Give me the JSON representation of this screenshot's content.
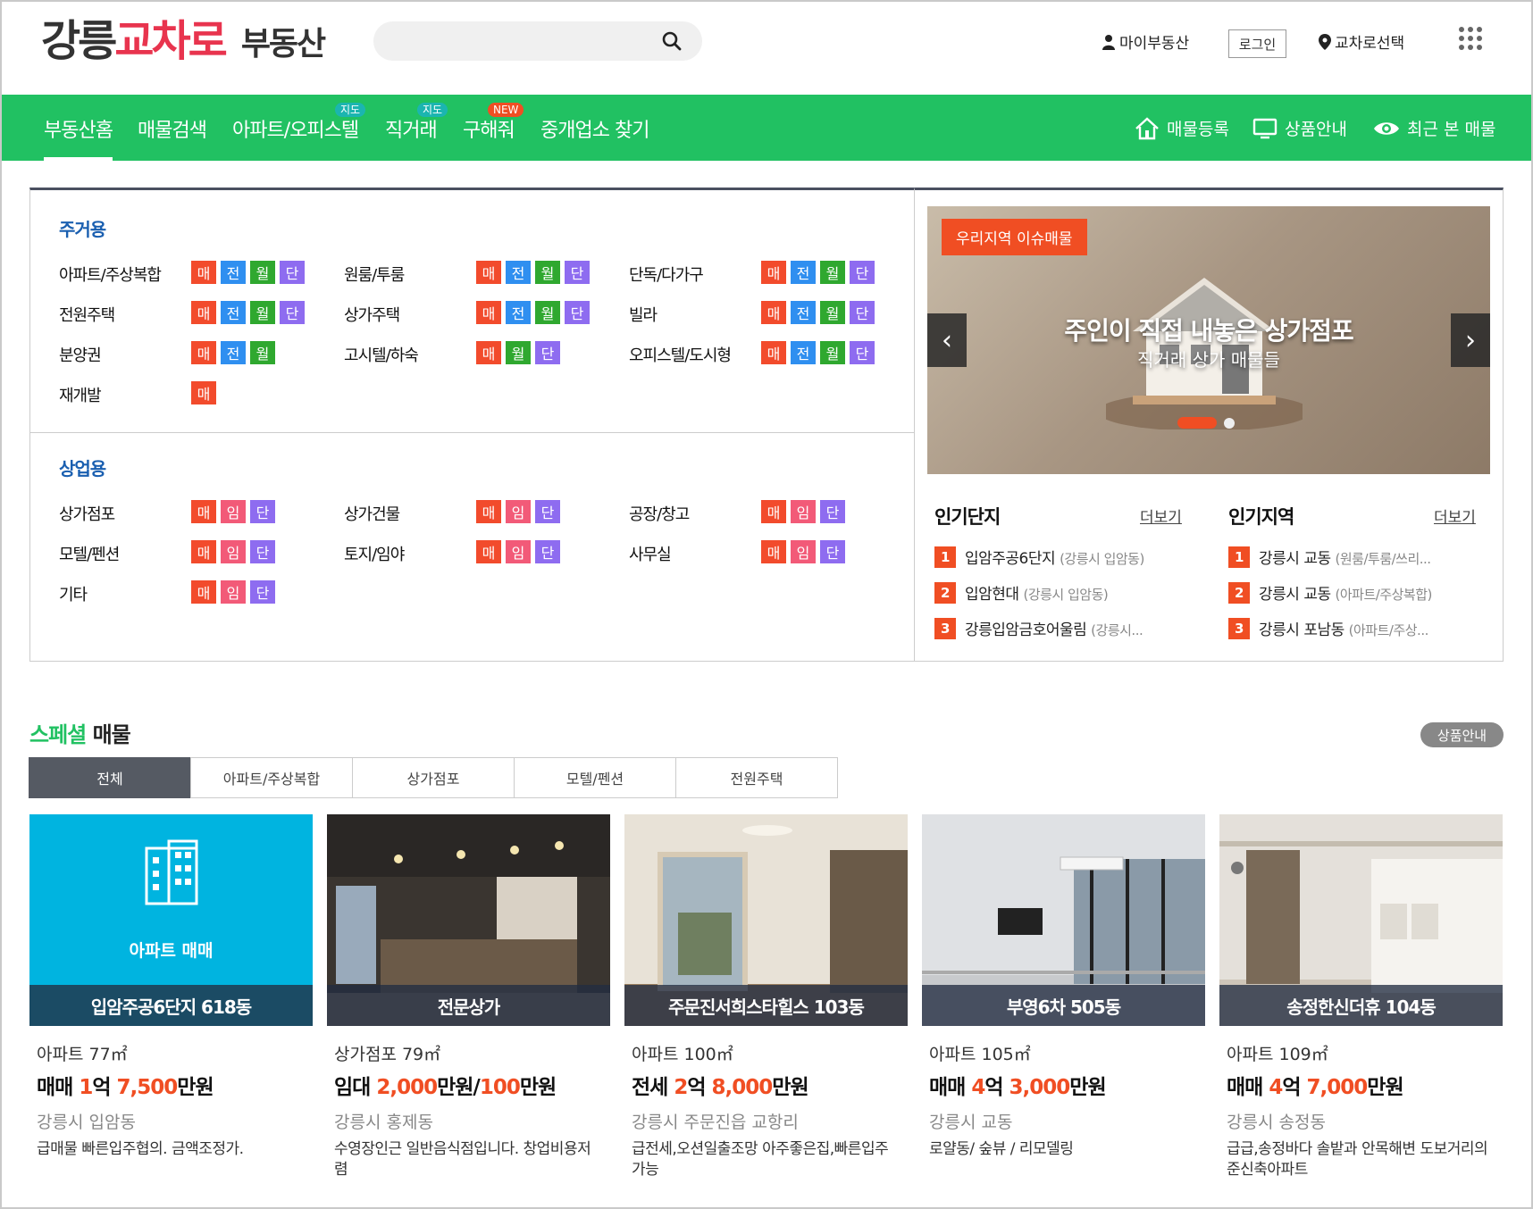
{
  "header": {
    "logo": {
      "part1": "강릉",
      "part2": "교차로",
      "part3": "부동산"
    },
    "search_placeholder": "",
    "my_realty": "마이부동산",
    "login": "로그인",
    "region_select": "교차로선택"
  },
  "nav": {
    "items": [
      {
        "label": "부동산홈",
        "badge": ""
      },
      {
        "label": "매물검색",
        "badge": ""
      },
      {
        "label": "아파트/오피스텔",
        "badge": "지도"
      },
      {
        "label": "직거래",
        "badge": "지도"
      },
      {
        "label": "구해줘",
        "badge": "NEW"
      },
      {
        "label": "중개업소 찾기",
        "badge": ""
      }
    ],
    "right": {
      "register": "매물등록",
      "products": "상품안내",
      "recent": "최근 본 매물"
    }
  },
  "tags": {
    "mae": "매",
    "jeon": "전",
    "wol": "월",
    "dan": "단",
    "im": "임"
  },
  "residential": {
    "title": "주거용",
    "rows": [
      [
        "아파트/주상복합",
        "원룸/투룸",
        "단독/다가구"
      ],
      [
        "전원주택",
        "상가주택",
        "빌라"
      ],
      [
        "분양권",
        "고시텔/하숙",
        "오피스텔/도시형"
      ],
      [
        "재개발"
      ]
    ]
  },
  "commercial": {
    "title": "상업용",
    "rows": [
      [
        "상가점포",
        "상가건물",
        "공장/창고"
      ],
      [
        "모텔/펜션",
        "토지/임야",
        "사무실"
      ],
      [
        "기타"
      ]
    ]
  },
  "banner": {
    "tag": "우리지역 이슈매물",
    "title": "주인이 직접 내놓은 상가점포",
    "subtitle": "직거래 상가 매물들",
    "prev": "‹",
    "next": "›"
  },
  "popular_complex": {
    "title": "인기단지",
    "more": "더보기",
    "items": [
      {
        "rank": "1",
        "name": "입암주공6단지",
        "sub": "(강릉시 입암동)"
      },
      {
        "rank": "2",
        "name": "입암현대",
        "sub": "(강릉시 입암동)"
      },
      {
        "rank": "3",
        "name": "강릉입암금호어울림",
        "sub": "(강릉시..."
      }
    ]
  },
  "popular_region": {
    "title": "인기지역",
    "more": "더보기",
    "items": [
      {
        "rank": "1",
        "name": "강릉시 교동",
        "sub": "(원룸/투룸/쓰리..."
      },
      {
        "rank": "2",
        "name": "강릉시 교동",
        "sub": "(아파트/주상복합)"
      },
      {
        "rank": "3",
        "name": "강릉시 포남동",
        "sub": "(아파트/주상..."
      }
    ]
  },
  "special": {
    "title_green": "스페셜",
    "title_black": " 매물",
    "info_button": "상품안내",
    "tabs": [
      "전체",
      "아파트/주상복합",
      "상가점포",
      "모텔/펜션",
      "전원주택"
    ]
  },
  "cards": [
    {
      "placeholder_label": "아파트 매매",
      "caption": "입암주공6단지 618동",
      "type": "아파트 77㎡",
      "price_prefix": "매매 ",
      "price_parts": [
        "1",
        "억 ",
        "7,500",
        "만원"
      ],
      "location": "강릉시 입암동",
      "desc": "급매물 빠른입주협의. 금액조정가."
    },
    {
      "placeholder_label": "",
      "caption": "전문상가",
      "type": "상가점포 79㎡",
      "price_prefix": "임대 ",
      "price_parts": [
        "2,000",
        "만원/",
        "100",
        "만원"
      ],
      "location": "강릉시 홍제동",
      "desc": "수영장인근 일반음식점입니다. 창업비용저렴"
    },
    {
      "placeholder_label": "",
      "caption": "주문진서희스타힐스 103동",
      "type": "아파트 100㎡",
      "price_prefix": "전세 ",
      "price_parts": [
        "2",
        "억 ",
        "8,000",
        "만원"
      ],
      "location": "강릉시 주문진읍 교항리",
      "desc": "급전세,오션일출조망 아주좋은집,빠른입주가능"
    },
    {
      "placeholder_label": "",
      "caption": "부영6차 505동",
      "type": "아파트 105㎡",
      "price_prefix": "매매 ",
      "price_parts": [
        "4",
        "억 ",
        "3,000",
        "만원"
      ],
      "location": "강릉시 교동",
      "desc": "로얄동/ 숲뷰 / 리모델링"
    },
    {
      "placeholder_label": "",
      "caption": "송정한신더휴 104동",
      "type": "아파트 109㎡",
      "price_prefix": "매매 ",
      "price_parts": [
        "4",
        "억 ",
        "7,000",
        "만원"
      ],
      "location": "강릉시 송정동",
      "desc": "급급,송정바다 솔밭과 안목해변 도보거리의 준신축아파트"
    }
  ]
}
